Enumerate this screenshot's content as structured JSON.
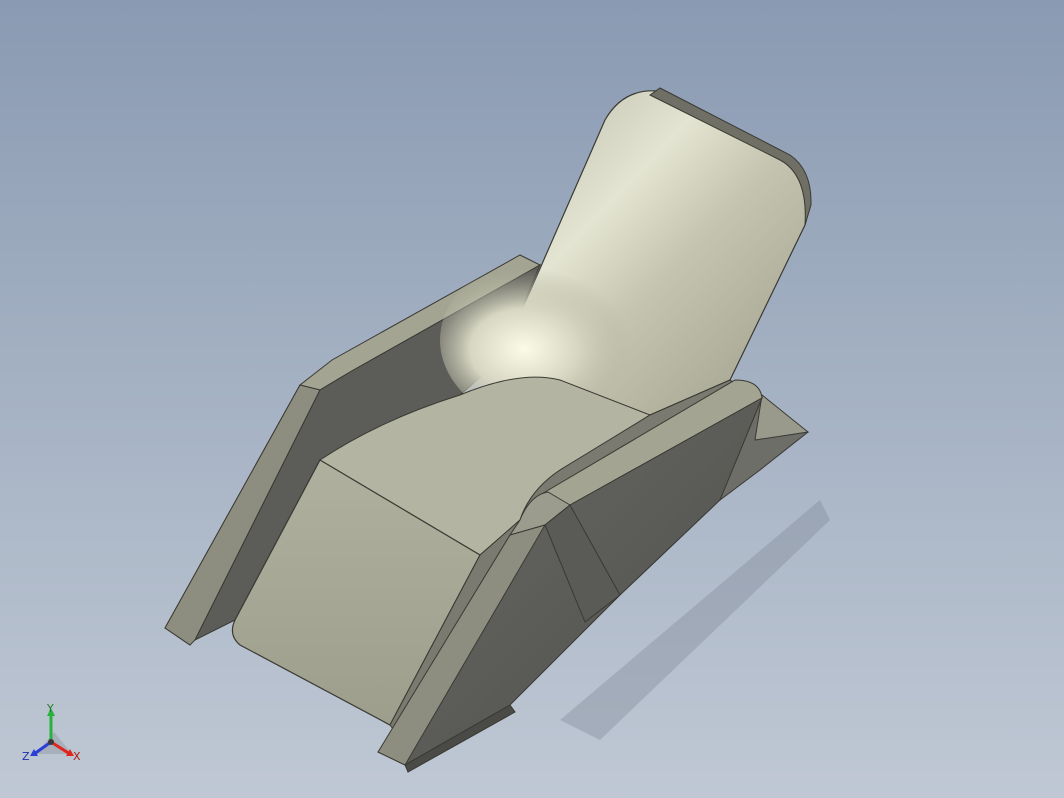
{
  "viewport": {
    "background_top": "#8a9ab2",
    "background_bottom": "#bfc8d4",
    "model": {
      "subject": "lounge chair",
      "body_color": "#a6a594",
      "edge_color": "#3a3a34"
    }
  },
  "triad": {
    "x_label": "X",
    "y_label": "Y",
    "z_label": "Z",
    "x_color": "#e0261c",
    "y_color": "#27b23a",
    "z_color": "#2b3fd6"
  }
}
